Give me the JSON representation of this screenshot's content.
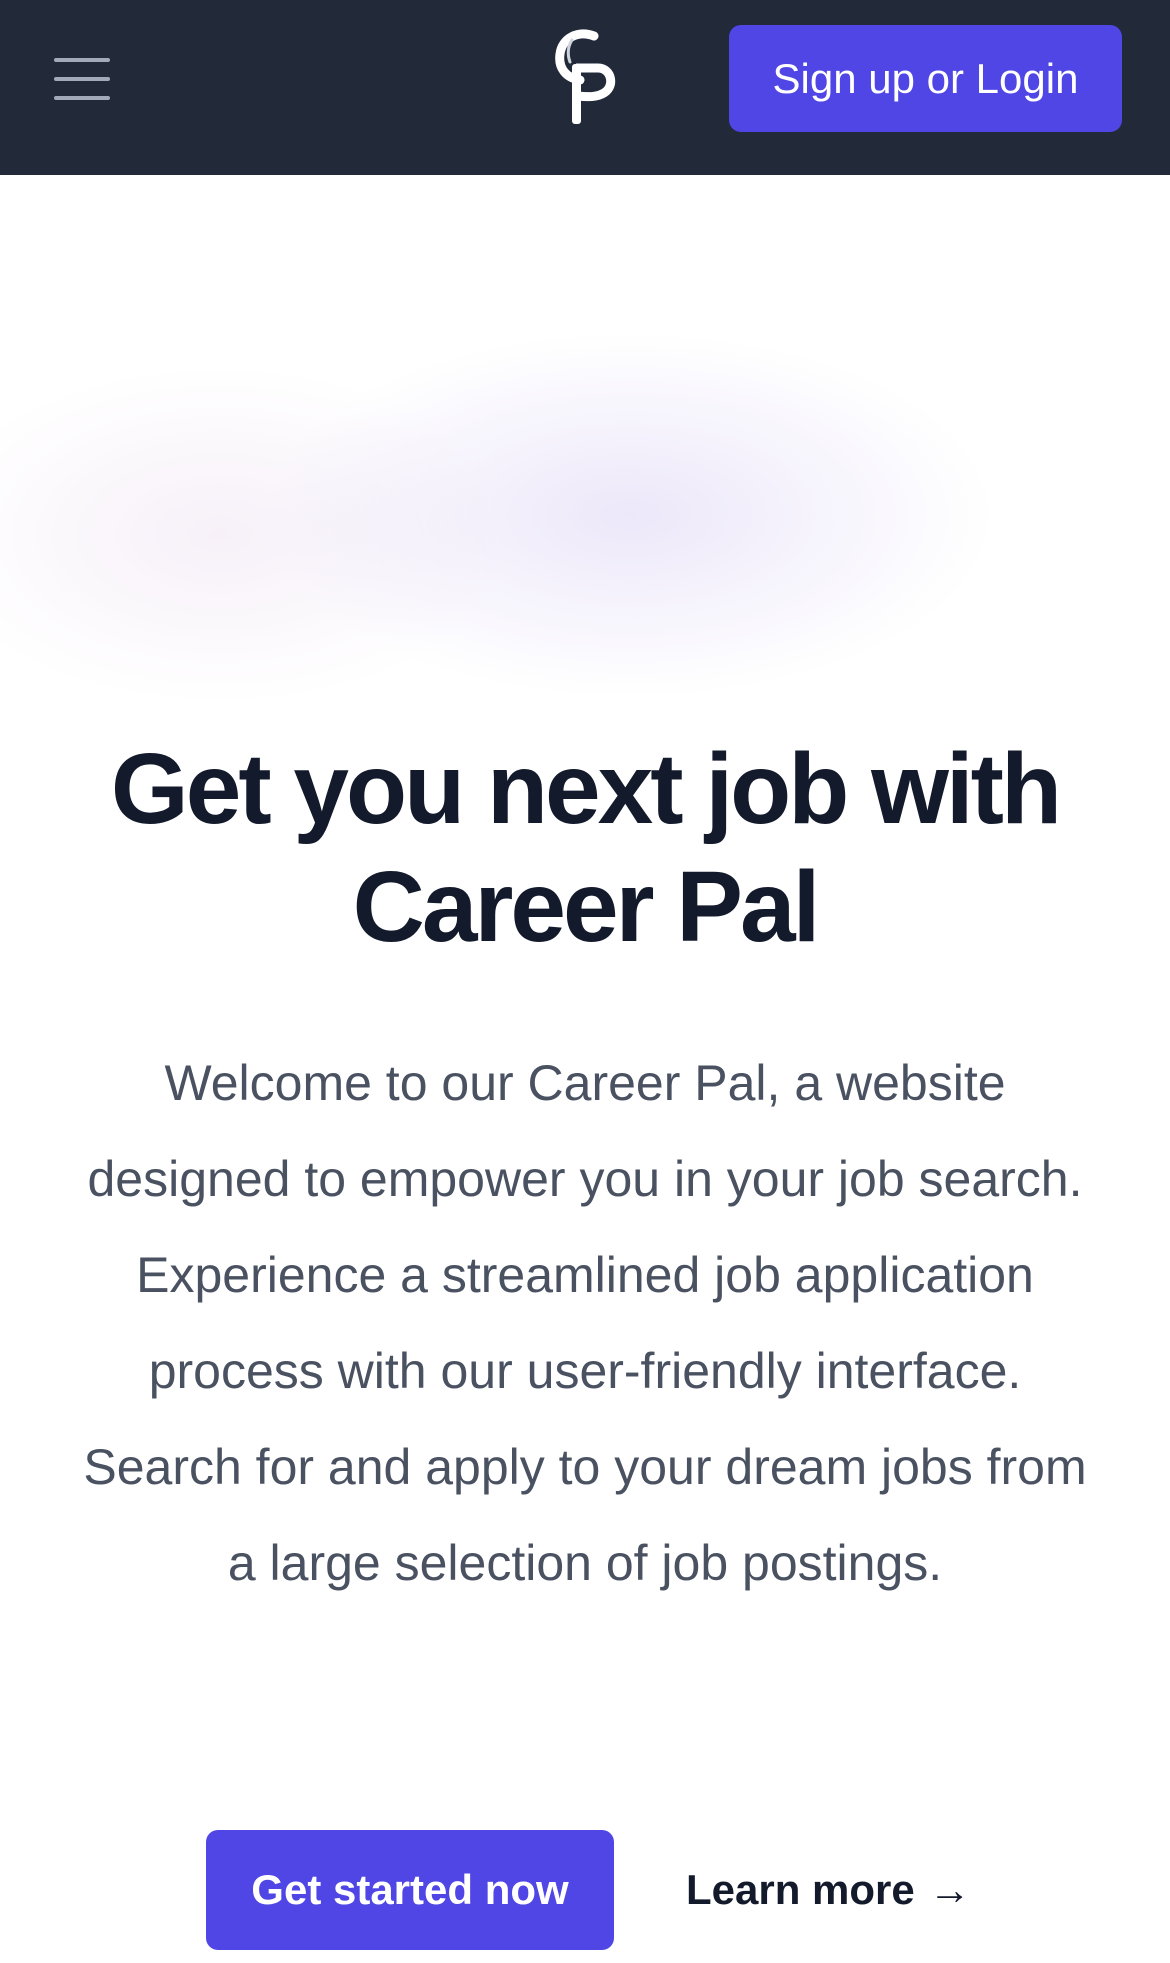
{
  "header": {
    "menu_icon": "hamburger-menu-icon",
    "logo_icon": "career-pal-logo",
    "signup_label": "Sign up or Login"
  },
  "hero": {
    "headline_line1": "Get you next job with",
    "headline_line2": "Career Pal",
    "description": "Welcome to our Career Pal, a website designed to empower you in your job search. Experience a streamlined job application process with our user-friendly interface. Search for and apply to your dream jobs from a large selection of job postings.",
    "primary_cta": "Get started now",
    "secondary_cta": "Learn more",
    "secondary_cta_arrow": "→"
  },
  "colors": {
    "header_bg": "#222a3a",
    "accent": "#4f46e5",
    "heading": "#131a2b",
    "body_text": "#4a5262"
  }
}
